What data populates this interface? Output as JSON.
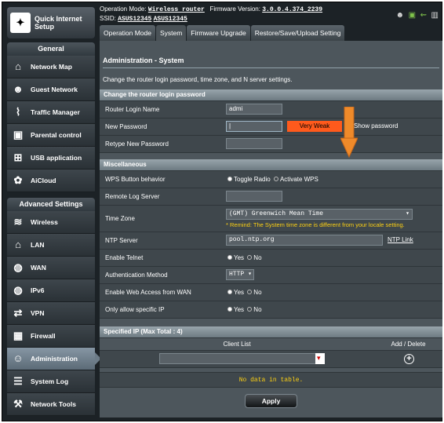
{
  "sidebar": {
    "qis_label": "Quick Internet Setup",
    "general_title": "General",
    "general_items": [
      "Network Map",
      "Guest Network",
      "Traffic Manager",
      "Parental control",
      "USB application",
      "AiCloud"
    ],
    "advanced_title": "Advanced Settings",
    "advanced_items": [
      "Wireless",
      "LAN",
      "WAN",
      "IPv6",
      "VPN",
      "Firewall",
      "Administration",
      "System Log",
      "Network Tools"
    ],
    "active_item": "Administration"
  },
  "topbar": {
    "op_mode_label": "Operation Mode:",
    "op_mode_value": "Wireless router",
    "firmware_label": "Firmware Version:",
    "firmware_value": "3.0.0.4.374_2239",
    "ssid_label": "SSID:",
    "ssid_1": "ASUS12345",
    "ssid_2": "ASUS12345"
  },
  "tabs": [
    "Operation Mode",
    "System",
    "Firmware Upgrade",
    "Restore/Save/Upload Setting"
  ],
  "active_tab": "System",
  "page": {
    "title": "Administration - System",
    "description": "Change the router login password, time zone, and N    server settings."
  },
  "section_password": {
    "title": "Change the router login password",
    "login_name_label": "Router Login Name",
    "login_name_value": "admi",
    "new_password_label": "New Password",
    "strength": "Very Weak",
    "show_password": "Show password",
    "retype_label": "Retype New Password"
  },
  "section_misc": {
    "title": "Miscellaneous",
    "wps_label": "WPS Button behavior",
    "wps_opt1": "Toggle Radio",
    "wps_opt2": "Activate WPS",
    "remote_log_label": "Remote Log Server",
    "timezone_label": "Time Zone",
    "timezone_value": "(GMT) Greenwich Mean Time",
    "timezone_remind": "* Remind: The System time zone is different from your locale setting.",
    "ntp_label": "NTP Server",
    "ntp_value": "pool.ntp.org",
    "ntp_link": "NTP Link",
    "telnet_label": "Enable Telnet",
    "auth_label": "Authentication Method",
    "auth_value": "HTTP",
    "web_wan_label": "Enable Web Access from WAN",
    "only_ip_label": "Only allow specific IP",
    "yes": "Yes",
    "no": "No"
  },
  "section_ip": {
    "title": "Specified IP (Max Total : 4)",
    "col_client": "Client List",
    "col_add": "Add / Delete",
    "empty": "No data in table."
  },
  "apply_label": "Apply"
}
